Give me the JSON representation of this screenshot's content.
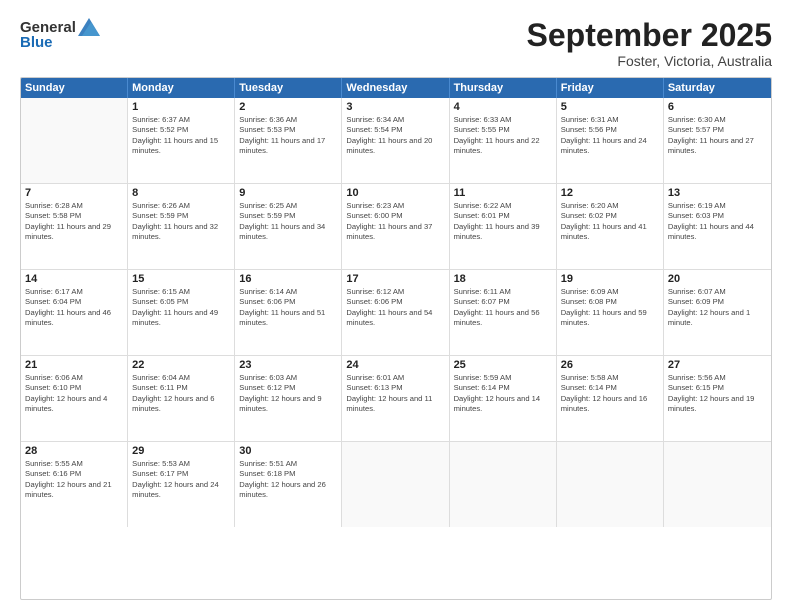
{
  "logo": {
    "general": "General",
    "blue": "Blue"
  },
  "header": {
    "month": "September 2025",
    "location": "Foster, Victoria, Australia"
  },
  "days_of_week": [
    "Sunday",
    "Monday",
    "Tuesday",
    "Wednesday",
    "Thursday",
    "Friday",
    "Saturday"
  ],
  "weeks": [
    [
      {
        "day": "",
        "empty": true
      },
      {
        "day": "1",
        "sunrise": "Sunrise: 6:37 AM",
        "sunset": "Sunset: 5:52 PM",
        "daylight": "Daylight: 11 hours and 15 minutes."
      },
      {
        "day": "2",
        "sunrise": "Sunrise: 6:36 AM",
        "sunset": "Sunset: 5:53 PM",
        "daylight": "Daylight: 11 hours and 17 minutes."
      },
      {
        "day": "3",
        "sunrise": "Sunrise: 6:34 AM",
        "sunset": "Sunset: 5:54 PM",
        "daylight": "Daylight: 11 hours and 20 minutes."
      },
      {
        "day": "4",
        "sunrise": "Sunrise: 6:33 AM",
        "sunset": "Sunset: 5:55 PM",
        "daylight": "Daylight: 11 hours and 22 minutes."
      },
      {
        "day": "5",
        "sunrise": "Sunrise: 6:31 AM",
        "sunset": "Sunset: 5:56 PM",
        "daylight": "Daylight: 11 hours and 24 minutes."
      },
      {
        "day": "6",
        "sunrise": "Sunrise: 6:30 AM",
        "sunset": "Sunset: 5:57 PM",
        "daylight": "Daylight: 11 hours and 27 minutes."
      }
    ],
    [
      {
        "day": "7",
        "sunrise": "Sunrise: 6:28 AM",
        "sunset": "Sunset: 5:58 PM",
        "daylight": "Daylight: 11 hours and 29 minutes."
      },
      {
        "day": "8",
        "sunrise": "Sunrise: 6:26 AM",
        "sunset": "Sunset: 5:59 PM",
        "daylight": "Daylight: 11 hours and 32 minutes."
      },
      {
        "day": "9",
        "sunrise": "Sunrise: 6:25 AM",
        "sunset": "Sunset: 5:59 PM",
        "daylight": "Daylight: 11 hours and 34 minutes."
      },
      {
        "day": "10",
        "sunrise": "Sunrise: 6:23 AM",
        "sunset": "Sunset: 6:00 PM",
        "daylight": "Daylight: 11 hours and 37 minutes."
      },
      {
        "day": "11",
        "sunrise": "Sunrise: 6:22 AM",
        "sunset": "Sunset: 6:01 PM",
        "daylight": "Daylight: 11 hours and 39 minutes."
      },
      {
        "day": "12",
        "sunrise": "Sunrise: 6:20 AM",
        "sunset": "Sunset: 6:02 PM",
        "daylight": "Daylight: 11 hours and 41 minutes."
      },
      {
        "day": "13",
        "sunrise": "Sunrise: 6:19 AM",
        "sunset": "Sunset: 6:03 PM",
        "daylight": "Daylight: 11 hours and 44 minutes."
      }
    ],
    [
      {
        "day": "14",
        "sunrise": "Sunrise: 6:17 AM",
        "sunset": "Sunset: 6:04 PM",
        "daylight": "Daylight: 11 hours and 46 minutes."
      },
      {
        "day": "15",
        "sunrise": "Sunrise: 6:15 AM",
        "sunset": "Sunset: 6:05 PM",
        "daylight": "Daylight: 11 hours and 49 minutes."
      },
      {
        "day": "16",
        "sunrise": "Sunrise: 6:14 AM",
        "sunset": "Sunset: 6:06 PM",
        "daylight": "Daylight: 11 hours and 51 minutes."
      },
      {
        "day": "17",
        "sunrise": "Sunrise: 6:12 AM",
        "sunset": "Sunset: 6:06 PM",
        "daylight": "Daylight: 11 hours and 54 minutes."
      },
      {
        "day": "18",
        "sunrise": "Sunrise: 6:11 AM",
        "sunset": "Sunset: 6:07 PM",
        "daylight": "Daylight: 11 hours and 56 minutes."
      },
      {
        "day": "19",
        "sunrise": "Sunrise: 6:09 AM",
        "sunset": "Sunset: 6:08 PM",
        "daylight": "Daylight: 11 hours and 59 minutes."
      },
      {
        "day": "20",
        "sunrise": "Sunrise: 6:07 AM",
        "sunset": "Sunset: 6:09 PM",
        "daylight": "Daylight: 12 hours and 1 minute."
      }
    ],
    [
      {
        "day": "21",
        "sunrise": "Sunrise: 6:06 AM",
        "sunset": "Sunset: 6:10 PM",
        "daylight": "Daylight: 12 hours and 4 minutes."
      },
      {
        "day": "22",
        "sunrise": "Sunrise: 6:04 AM",
        "sunset": "Sunset: 6:11 PM",
        "daylight": "Daylight: 12 hours and 6 minutes."
      },
      {
        "day": "23",
        "sunrise": "Sunrise: 6:03 AM",
        "sunset": "Sunset: 6:12 PM",
        "daylight": "Daylight: 12 hours and 9 minutes."
      },
      {
        "day": "24",
        "sunrise": "Sunrise: 6:01 AM",
        "sunset": "Sunset: 6:13 PM",
        "daylight": "Daylight: 12 hours and 11 minutes."
      },
      {
        "day": "25",
        "sunrise": "Sunrise: 5:59 AM",
        "sunset": "Sunset: 6:14 PM",
        "daylight": "Daylight: 12 hours and 14 minutes."
      },
      {
        "day": "26",
        "sunrise": "Sunrise: 5:58 AM",
        "sunset": "Sunset: 6:14 PM",
        "daylight": "Daylight: 12 hours and 16 minutes."
      },
      {
        "day": "27",
        "sunrise": "Sunrise: 5:56 AM",
        "sunset": "Sunset: 6:15 PM",
        "daylight": "Daylight: 12 hours and 19 minutes."
      }
    ],
    [
      {
        "day": "28",
        "sunrise": "Sunrise: 5:55 AM",
        "sunset": "Sunset: 6:16 PM",
        "daylight": "Daylight: 12 hours and 21 minutes."
      },
      {
        "day": "29",
        "sunrise": "Sunrise: 5:53 AM",
        "sunset": "Sunset: 6:17 PM",
        "daylight": "Daylight: 12 hours and 24 minutes."
      },
      {
        "day": "30",
        "sunrise": "Sunrise: 5:51 AM",
        "sunset": "Sunset: 6:18 PM",
        "daylight": "Daylight: 12 hours and 26 minutes."
      },
      {
        "day": "",
        "empty": true
      },
      {
        "day": "",
        "empty": true
      },
      {
        "day": "",
        "empty": true
      },
      {
        "day": "",
        "empty": true
      }
    ]
  ]
}
